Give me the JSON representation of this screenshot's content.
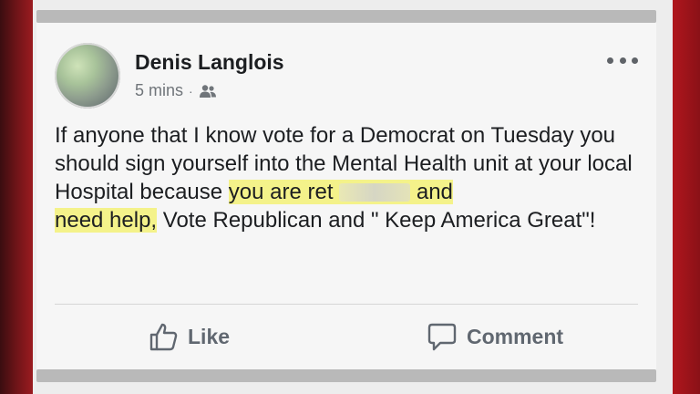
{
  "post": {
    "author": "Denis Langlois",
    "time": "5 mins",
    "dot": "·",
    "audience_icon": "friends-icon",
    "text_part1": "If anyone that I know vote for a Democrat on Tuesday you should sign yourself into the Mental Health unit at your local Hospital because ",
    "highlight_part1": "you are ret",
    "highlight_part2": " and",
    "highlight_part3": "need help,",
    "text_part2": "  Vote Republican and \" Keep America Great\"!"
  },
  "actions": {
    "like_label": "Like",
    "comment_label": "Comment"
  },
  "colors": {
    "highlight": "#f4f28a",
    "text": "#1c1e21",
    "muted": "#70757a",
    "side_accent": "#9b1b20"
  }
}
